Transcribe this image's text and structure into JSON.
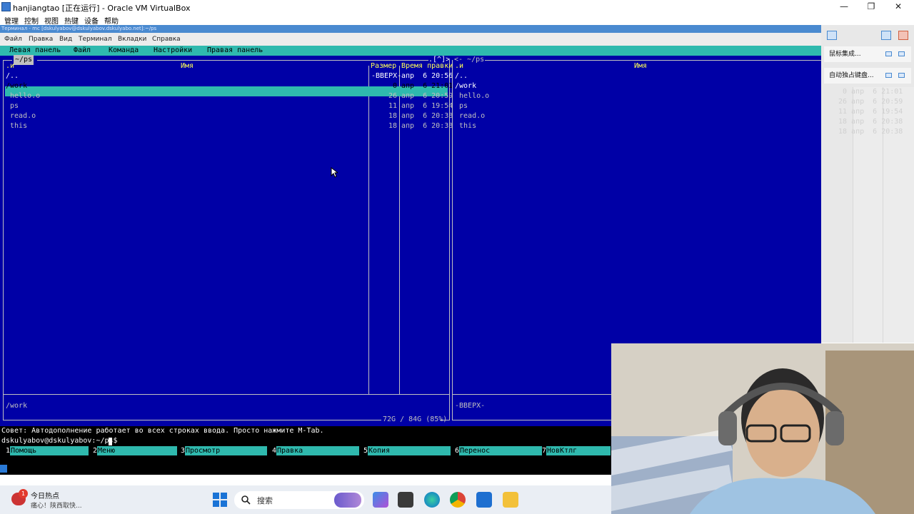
{
  "window": {
    "title": "hanjiangtao [正在运行] - Oracle VM VirtualBox"
  },
  "vbox_menu": [
    "管理",
    "控制",
    "视图",
    "热键",
    "设备",
    "帮助"
  ],
  "terminal": {
    "title": "Терминал - mc [dskulyabov@dskulyabov.dskulyabo.net]:~/ps",
    "menu": [
      "Файл",
      "Правка",
      "Вид",
      "Терминал",
      "Вкладки",
      "Справка"
    ]
  },
  "mc": {
    "menubar": [
      "Левая панель",
      "Файл",
      "Команда",
      "Настройки",
      "Правая панель"
    ],
    "left_panel": {
      "path": "~/ps",
      "corner": ".[^]>",
      "col_name_marker": ".и",
      "col_name": "Имя",
      "col_size": "Размер",
      "col_time": "Время правки",
      "rows": [
        {
          "name": "/..",
          "size": "-ВВЕРХ-",
          "time": "апр  6 20:56"
        },
        {
          "name": "/work",
          "size": "0",
          "time": "апр  6 21:01"
        },
        {
          "name": " hello.o",
          "size": "26",
          "time": "апр  6 20:59"
        },
        {
          "name": " ps",
          "size": "11",
          "time": "апр  6 19:54"
        },
        {
          "name": " read.o",
          "size": "18",
          "time": "апр  6 20:38"
        },
        {
          "name": " this",
          "size": "18",
          "time": "апр  6 20:38"
        }
      ],
      "mini_status": "/work",
      "disk": "72G / 84G (85%)"
    },
    "right_panel": {
      "path": "<- ~/ps",
      "col_name_marker": ".и",
      "col_name": "Имя",
      "rows": [
        "/..",
        "/work",
        " hello.o",
        " ps",
        " read.o",
        " this"
      ],
      "ghost_rows": [
        "0 апр  6 21:01",
        "26 апр  6 20:59",
        "11 апр  6 19:54",
        "18 апр  6 20:38",
        "18 апр  6 20:38"
      ],
      "mini_status": "-ВВЕРХ-"
    },
    "hint": "Совет: Автодополнение работает во всех строках ввода. Просто нажмите M-Tab.",
    "prompt": "dskulyabov@dskulyabov:~/ps$",
    "fkeys": [
      {
        "n": "1",
        "label": "Помощь"
      },
      {
        "n": "2",
        "label": "Меню"
      },
      {
        "n": "3",
        "label": "Просмотр"
      },
      {
        "n": "4",
        "label": "Правка"
      },
      {
        "n": "5",
        "label": "Копия"
      },
      {
        "n": "6",
        "label": "Перенос"
      },
      {
        "n": "7",
        "label": "НовКтлг"
      }
    ]
  },
  "side_panel": {
    "items": [
      "鼠标集成...",
      "自动独占键盘..."
    ]
  },
  "taskbar": {
    "news_badge": "1",
    "news_title": "今日热点",
    "news_sub": "痛心！陕西取快...",
    "search": "搜索"
  },
  "colors": {
    "mc_blue": "#0000a6",
    "mc_cyan": "#2fb9ae"
  }
}
